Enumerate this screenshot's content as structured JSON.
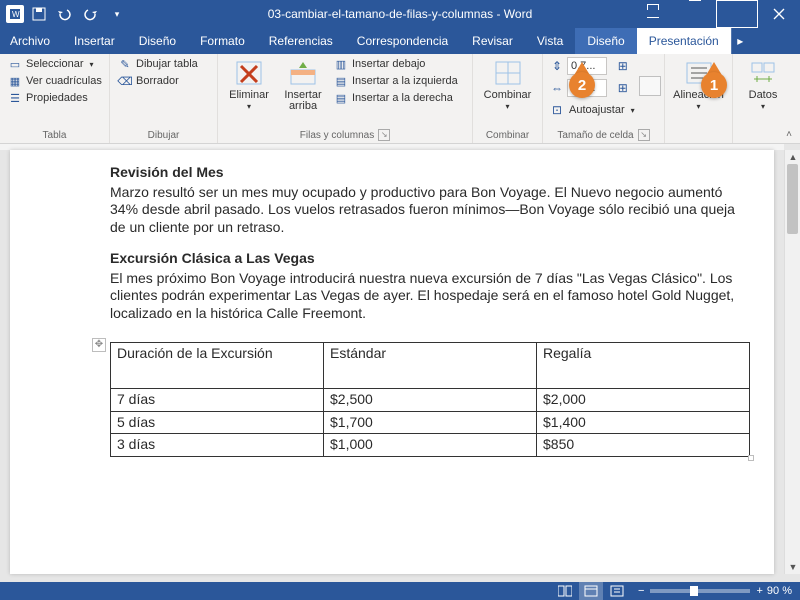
{
  "titlebar": {
    "doc_title": "03-cambiar-el-tamano-de-filas-y-columnas - Word"
  },
  "tabs": {
    "file": "Archivo",
    "insert": "Insertar",
    "design": "Diseño",
    "format": "Formato",
    "references": "Referencias",
    "mail": "Correspondencia",
    "review": "Revisar",
    "view": "Vista",
    "tdesign": "Diseño",
    "layout": "Presentación"
  },
  "ribbon": {
    "table": {
      "select": "Seleccionar",
      "gridlines": "Ver cuadrículas",
      "properties": "Propiedades",
      "label": "Tabla"
    },
    "draw": {
      "draw_table": "Dibujar tabla",
      "eraser": "Borrador",
      "label": "Dibujar"
    },
    "rowscols": {
      "delete": "Eliminar",
      "insert_above": "Insertar arriba",
      "insert_below": "Insertar debajo",
      "insert_left": "Insertar a la izquierda",
      "insert_right": "Insertar a la derecha",
      "label": "Filas y columnas"
    },
    "merge": {
      "combine": "Combinar",
      "label": "Combinar"
    },
    "cellsize": {
      "height_val": "0.7...",
      "width_val": "4.1...",
      "autofit": "Autoajustar",
      "label": "Tamaño de celda"
    },
    "align": {
      "label": "Alineación"
    },
    "data": {
      "label": "Datos"
    }
  },
  "callouts": {
    "one": "1",
    "two": "2"
  },
  "document": {
    "h1": "Revisión del Mes",
    "p1": "Marzo resultó ser un mes muy ocupado y productivo para Bon Voyage. El Nuevo negocio aumentó 34% desde abril pasado. Los vuelos retrasados fueron mínimos—Bon Voyage sólo recibió una queja de un cliente por un retraso.",
    "h2": "Excursión Clásica a Las Vegas",
    "p2": "El mes próximo Bon Voyage introducirá nuestra nueva excursión de 7 días \"Las Vegas Clásico\". Los clientes podrán experimentar Las Vegas de ayer. El hospedaje será en el famoso hotel Gold Nugget, localizado en la histórica Calle Freemont.",
    "table": {
      "headers": [
        "Duración de la Excursión",
        "Estándar",
        "Regalía"
      ],
      "rows": [
        [
          "7 días",
          "$2,500",
          "$2,000"
        ],
        [
          "5 días",
          "$1,700",
          "$1,400"
        ],
        [
          "3 días",
          "$1,000",
          "$850"
        ]
      ]
    }
  },
  "statusbar": {
    "zoom": "90 %"
  }
}
